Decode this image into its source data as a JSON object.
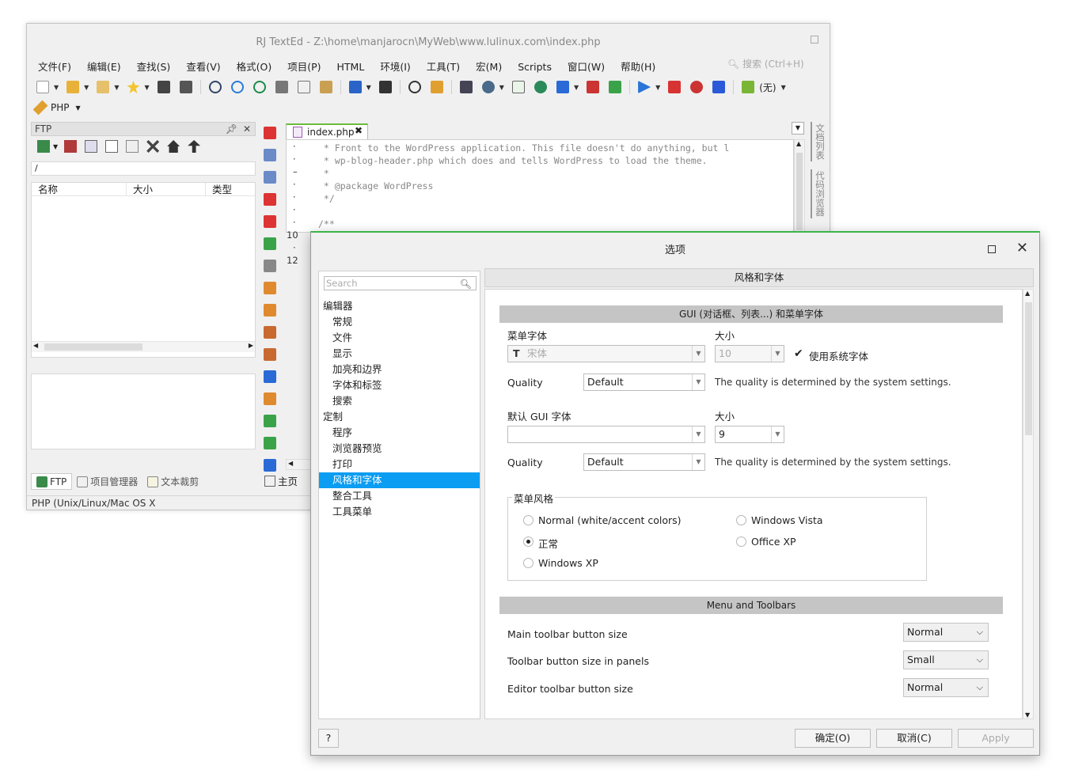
{
  "main": {
    "title": "RJ TextEd - Z:\\home\\manjarocn\\MyWeb\\www.lulinux.com\\index.php",
    "menus": [
      "文件(F)",
      "编辑(E)",
      "查找(S)",
      "查看(V)",
      "格式(O)",
      "项目(P)",
      "HTML",
      "环境(I)",
      "工具(T)",
      "宏(M)",
      "Scripts",
      "窗口(W)",
      "帮助(H)"
    ],
    "search_placeholder": "搜索 (Ctrl+H)",
    "toolbar2_label": "PHP",
    "ftp": {
      "title": "FTP",
      "path": "/",
      "columns": [
        "名称",
        "大小",
        "类型"
      ],
      "tabs": [
        "FTP",
        "项目管理器",
        "文本裁剪"
      ]
    },
    "editor": {
      "tab_label": "index.php",
      "gutter": [
        "·",
        "·",
        "–",
        "·",
        "·",
        "·",
        "·",
        "10",
        "·",
        "12"
      ],
      "code_lines": [
        " * Front to the WordPress application. This file doesn't do anything, but l",
        " * wp-blog-header.php which does and tells WordPress to load the theme.",
        " *",
        " * @package WordPress",
        " */",
        "",
        "/**"
      ],
      "side_tabs": [
        "文档列表",
        "代码浏览器"
      ],
      "home_label": "主页"
    },
    "status": "PHP (Unix/Linux/Mac OS X"
  },
  "dialog": {
    "title": "选项",
    "search_placeholder": "Search",
    "nav": [
      {
        "label": "编辑器",
        "level": 0
      },
      {
        "label": "常规",
        "level": 1
      },
      {
        "label": "文件",
        "level": 1
      },
      {
        "label": "显示",
        "level": 1
      },
      {
        "label": "加亮和边界",
        "level": 1
      },
      {
        "label": "字体和标签",
        "level": 1
      },
      {
        "label": "搜索",
        "level": 1
      },
      {
        "label": "定制",
        "level": 0
      },
      {
        "label": "程序",
        "level": 1
      },
      {
        "label": "浏览器预览",
        "level": 1
      },
      {
        "label": "打印",
        "level": 1
      },
      {
        "label": "风格和字体",
        "level": 1,
        "selected": true
      },
      {
        "label": "整合工具",
        "level": 1
      },
      {
        "label": "工具菜单",
        "level": 1
      }
    ],
    "pane_title": "风格和字体",
    "gui_section": "GUI (对话框、列表...) 和菜单字体",
    "menu_font_label": "菜单字体",
    "size_label": "大小",
    "menu_font_value": "宋体",
    "menu_size_value": "10",
    "use_system_font": "使用系统字体",
    "quality_label": "Quality",
    "quality_value": "Default",
    "quality_note": "The quality is determined by the system settings.",
    "default_gui_font_label": "默认 GUI 字体",
    "default_size_value": "9",
    "menu_style_label": "菜单风格",
    "styles": [
      "Normal (white/accent colors)",
      "正常",
      "Windows XP",
      "Windows Vista",
      "Office XP"
    ],
    "selected_style": "正常",
    "toolbar_section": "Menu and Toolbars",
    "toolbar_rows": [
      {
        "label": "Main toolbar button size",
        "value": "Normal"
      },
      {
        "label": "Toolbar button size in panels",
        "value": "Small"
      },
      {
        "label": "Editor toolbar button size",
        "value": "Normal"
      }
    ],
    "buttons": {
      "help": "?",
      "ok": "确定(O)",
      "cancel": "取消(C)",
      "apply": "Apply"
    }
  }
}
